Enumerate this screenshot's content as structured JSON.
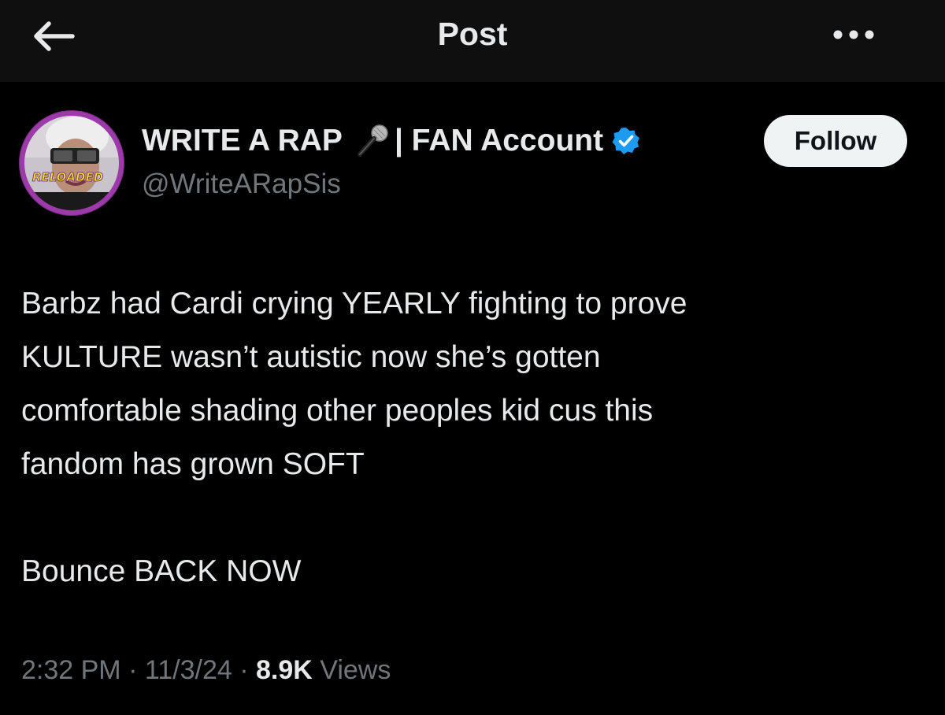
{
  "header": {
    "title": "Post",
    "back_icon": "arrow-left-icon",
    "more_icon": "more-horizontal-icon"
  },
  "author": {
    "display_name_part1": "WRITE A RAP",
    "display_name_part2": "| FAN Account",
    "handle": "@WriteARapSis",
    "mic_icon": "microphone-icon",
    "verified_icon": "verified-badge-icon",
    "avatar_text": "RELOADED",
    "follow_label": "Follow"
  },
  "post": {
    "lines": [
      "Barbz had Cardi crying YEARLY fighting to prove",
      "KULTURE wasn’t autistic now she’s gotten",
      "comfortable shading other peoples kid cus this",
      "fandom has grown SOFT"
    ],
    "closing_line": "Bounce  BACK  NOW"
  },
  "meta": {
    "time": "2:32 PM",
    "sep1": " · ",
    "date": "11/3/24",
    "sep2": " · ",
    "views_count": "8.9K",
    "views_label": " Views"
  },
  "colors": {
    "background": "#000000",
    "header_background": "#0f0f0f",
    "text": "#e7e9ea",
    "secondary_text": "#71767b",
    "verified": "#1d9bf0",
    "follow_button": "#eff3f4",
    "avatar_ring": "#7a2b84"
  }
}
